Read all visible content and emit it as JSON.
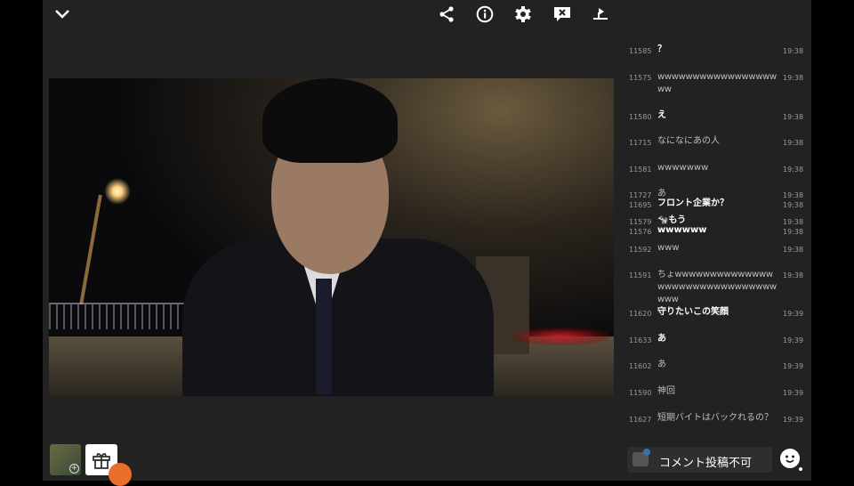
{
  "toolbar": {
    "icons": [
      "chevron-down-icon",
      "share-icon",
      "info-icon",
      "settings-icon",
      "comment-off-icon",
      "playlist-icon"
    ]
  },
  "comments": [
    {
      "no": "11585",
      "text": "？",
      "time": "19:38",
      "bold": true
    },
    {
      "no": "11575",
      "text": "wwwwwwwwwwwwwwwwwww",
      "time": "19:38",
      "bold": false
    },
    {
      "no": "11580",
      "text": "え",
      "time": "19:38",
      "bold": true
    },
    {
      "no": "11715",
      "text": "なになにあの人",
      "time": "19:38",
      "bold": false
    },
    {
      "no": "11581",
      "text": "wwwwwww",
      "time": "19:38",
      "bold": false
    },
    {
      "no": "11727",
      "text": "あ",
      "time": "19:38",
      "bold": false
    },
    {
      "no": "11695",
      "text": "フロント企業か？",
      "time": "19:38",
      "bold": true
    },
    {
      "no": "11579",
      "text": "🐄もう",
      "time": "19:38",
      "bold": true
    },
    {
      "no": "11576",
      "text": "wwwwww",
      "time": "19:38",
      "bold": true
    },
    {
      "no": "11592",
      "text": "www",
      "time": "19:38",
      "bold": false
    },
    {
      "no": "11591",
      "text": "ちょwwwwwwwwwwwwwwwwwwwwwwwwwwwwwwwwww",
      "time": "19:38",
      "bold": false
    },
    {
      "no": "11620",
      "text": "守りたいこの笑顔",
      "time": "19:39",
      "bold": true
    },
    {
      "no": "11633",
      "text": "あ",
      "time": "19:39",
      "bold": true
    },
    {
      "no": "11602",
      "text": "あ",
      "time": "19:39",
      "bold": false
    },
    {
      "no": "11590",
      "text": "神回",
      "time": "19:39",
      "bold": false
    },
    {
      "no": "11627",
      "text": "短期バイトはバックれるの？",
      "time": "19:39",
      "bold": false
    }
  ],
  "comment_input": {
    "placeholder": "コメント投稿不可"
  },
  "colors": {
    "background": "#222222",
    "accent": "#e8702a"
  }
}
